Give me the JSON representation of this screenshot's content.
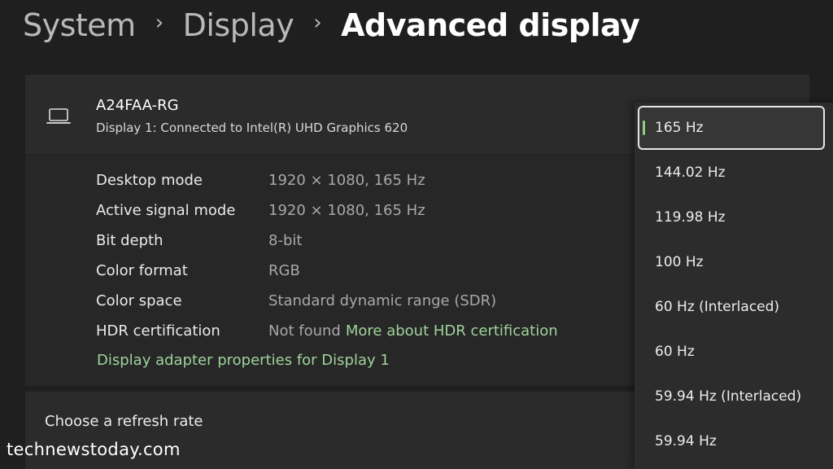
{
  "breadcrumb": {
    "items": [
      "System",
      "Display",
      "Advanced display"
    ],
    "separator": "›"
  },
  "display_card": {
    "icon": "laptop-icon",
    "name": "A24FAA-RG",
    "subtitle": "Display 1: Connected to Intel(R) UHD Graphics 620",
    "rows": [
      {
        "label": "Desktop mode",
        "value": "1920 × 1080, 165 Hz"
      },
      {
        "label": "Active signal mode",
        "value": "1920 × 1080, 165 Hz"
      },
      {
        "label": "Bit depth",
        "value": "8-bit"
      },
      {
        "label": "Color format",
        "value": "RGB"
      },
      {
        "label": "Color space",
        "value": "Standard dynamic range (SDR)"
      },
      {
        "label": "HDR certification",
        "value": "Not found",
        "link": "More about HDR certification"
      }
    ],
    "adapter_link": "Display adapter properties for Display 1"
  },
  "refresh_rate": {
    "label": "Choose a refresh rate",
    "selected": "165 Hz",
    "options": [
      "165 Hz",
      "144.02 Hz",
      "119.98 Hz",
      "100 Hz",
      "60 Hz (Interlaced)",
      "60 Hz",
      "59.94 Hz (Interlaced)",
      "59.94 Hz"
    ]
  },
  "watermark": "technewstoday.com",
  "colors": {
    "accent": "#8fd17d",
    "link": "#9fd39c",
    "background": "#1f1f1f",
    "card": "#2b2b2b"
  }
}
